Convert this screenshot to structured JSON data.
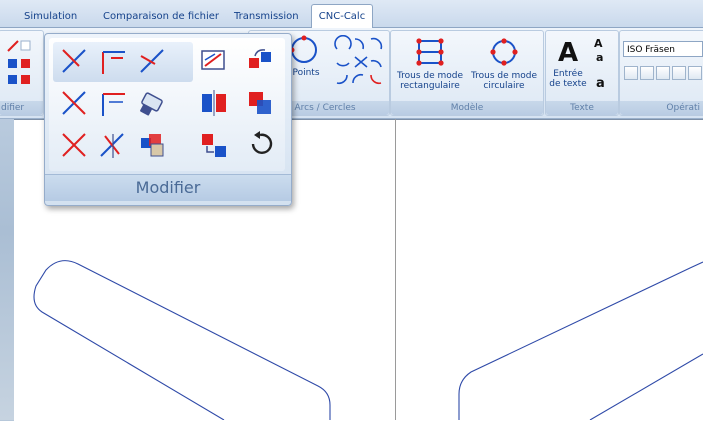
{
  "tabs": [
    "Simulation",
    "Comparaison de fichier",
    "Transmission",
    "CNC-Calc"
  ],
  "active_tab": "CNC-Calc",
  "ribbon": {
    "points_label": "Points",
    "arcs_group": "er Arcs / Cercles",
    "left_group_fragment": "difier",
    "trous_rect": "Trous de mode rectangulaire",
    "trous_circ": "Trous de mode circulaire",
    "modele_group": "Modèle",
    "entree_texte": "Entrée de texte",
    "texte_group": "Texte",
    "iso_value": "ISO Fräsen",
    "operation_group": "Opérati"
  },
  "popup": {
    "title": "Modifier"
  },
  "colors": {
    "accent": "#15428b",
    "red": "#e02020",
    "blue": "#1a52c8",
    "tool": "#3f4f8f"
  }
}
